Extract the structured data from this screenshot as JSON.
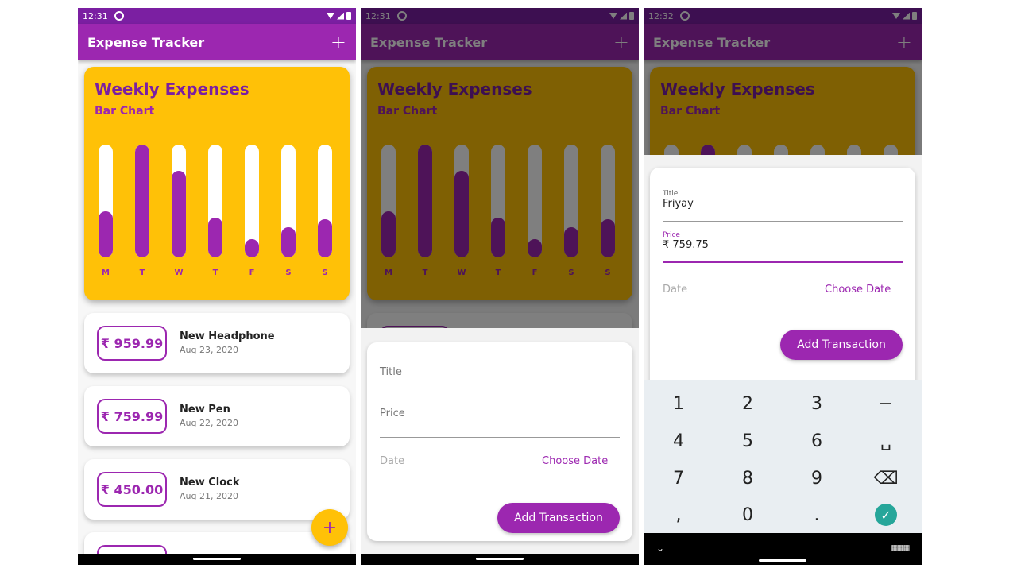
{
  "app": {
    "title": "Expense Tracker",
    "add_icon": "+",
    "colors": {
      "primary": "#9c27b0",
      "accent": "#ffc107",
      "dark": "#7b1fa2"
    }
  },
  "chart": {
    "title": "Weekly Expenses",
    "subtitle": "Bar Chart"
  },
  "chart_data": {
    "type": "bar",
    "title": "Weekly Expenses",
    "subtitle": "Bar Chart",
    "categories": [
      "M",
      "T",
      "W",
      "T",
      "F",
      "S",
      "S"
    ],
    "values": [
      0.41,
      1.0,
      0.77,
      0.35,
      0.16,
      0.27,
      0.34
    ],
    "ylim": [
      0,
      1
    ],
    "grid": false
  },
  "screens": [
    {
      "status_time": "12:31",
      "transactions": [
        {
          "amount": "₹ 959.99",
          "title": "New Headphone",
          "date": "Aug 23, 2020"
        },
        {
          "amount": "₹ 759.99",
          "title": "New Pen",
          "date": "Aug 22, 2020"
        },
        {
          "amount": "₹ 450.00",
          "title": "New Clock",
          "date": "Aug 21, 2020"
        }
      ],
      "fab_icon": "+"
    },
    {
      "status_time": "12:31",
      "form": {
        "title_label": "Title",
        "price_label": "Price",
        "date_label": "Date",
        "choose_date": "Choose Date",
        "add_button": "Add Transaction"
      }
    },
    {
      "status_time": "12:32",
      "form": {
        "title_label": "Title",
        "title_value": "Friyay",
        "price_label": "Price",
        "price_value": "₹ 759.75",
        "date_label": "Date",
        "choose_date": "Choose Date",
        "add_button": "Add Transaction"
      },
      "keypad": {
        "keys": [
          "1",
          "2",
          "3",
          "−",
          "4",
          "5",
          "6",
          "␣",
          "7",
          "8",
          "9",
          "⌫",
          ",",
          "0",
          ".",
          "✓"
        ]
      }
    }
  ]
}
